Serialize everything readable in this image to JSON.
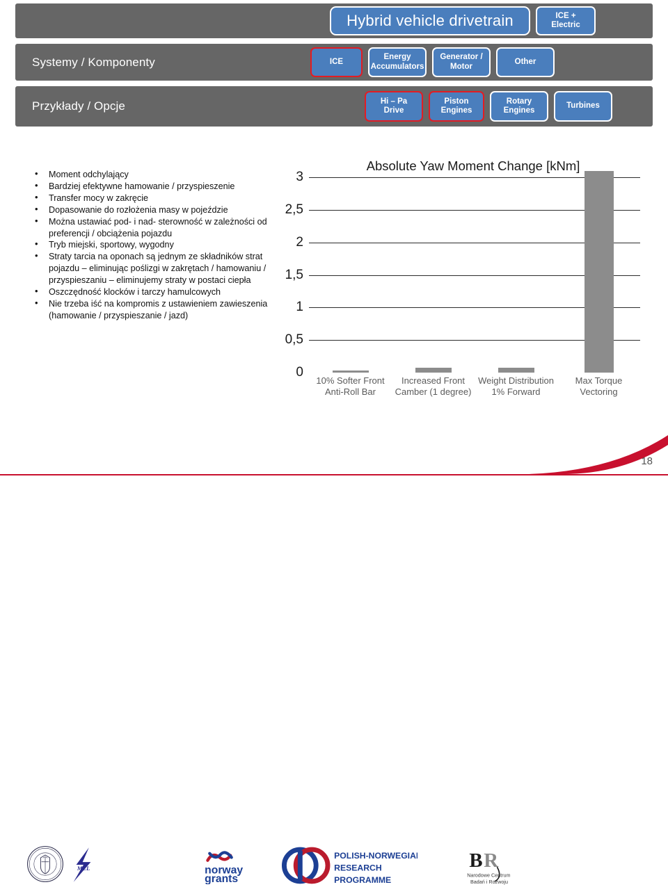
{
  "nav": {
    "rows": [
      {
        "label": "",
        "items": [
          {
            "name": "hybrid-vehicle-drivetrain",
            "label": "Hybrid vehicle drivetrain",
            "highlight": "white",
            "style": "title"
          },
          {
            "name": "ice-plus-electric",
            "label": "ICE +\nElectric",
            "highlight": "white",
            "style": "chip"
          }
        ]
      },
      {
        "label": "Systemy / Komponenty",
        "items": [
          {
            "name": "ice",
            "label": "ICE",
            "highlight": "red",
            "style": "chip"
          },
          {
            "name": "energy-accumulators",
            "label": "Energy\nAccumulators",
            "highlight": "white",
            "style": "chip"
          },
          {
            "name": "generator-motor",
            "label": "Generator /\nMotor",
            "highlight": "white",
            "style": "chip"
          },
          {
            "name": "other",
            "label": "Other",
            "highlight": "white",
            "style": "chip"
          }
        ]
      },
      {
        "label": "Przykłady / Opcje",
        "items": [
          {
            "name": "hi-pa-drive",
            "label": "Hi – Pa\nDrive",
            "highlight": "red",
            "style": "chip"
          },
          {
            "name": "piston-engines",
            "label": "Piston\nEngines",
            "highlight": "red",
            "style": "chip"
          },
          {
            "name": "rotary-engines",
            "label": "Rotary\nEngines",
            "highlight": "white",
            "style": "chip"
          },
          {
            "name": "turbines",
            "label": "Turbines",
            "highlight": "white",
            "style": "chip"
          }
        ]
      }
    ]
  },
  "bullets": [
    "Moment odchylający",
    "Bardziej efektywne hamowanie / przyspieszenie",
    "Transfer mocy w zakręcie",
    "Dopasowanie do rozłożenia masy w pojeździe",
    "Można ustawiać pod- i nad- sterowność w zależności od preferencji / obciążenia pojazdu",
    "Tryb miejski, sportowy, wygodny",
    "Straty tarcia na oponach są jednym ze składników strat pojazdu – eliminując poślizgi  w zakrętach / hamowaniu / przyspieszaniu – eliminujemy straty w postaci ciepła",
    "Oszczędność klocków i tarczy hamulcowych",
    "Nie trzeba iść na kompromis z ustawieniem zawieszenia (hamowanie / przyspieszanie / jazd)"
  ],
  "chart_data": {
    "type": "bar",
    "title": "Absolute Yaw Moment Change [kNm]",
    "xlabel": "",
    "ylabel": "",
    "categories": [
      "10% Softer Front Anti-Roll Bar",
      "Increased Front Camber (1 degree)",
      "Weight Distribution 1% Forward",
      "Max Torque Vectoring"
    ],
    "values": [
      0.03,
      0.07,
      0.08,
      3.1
    ],
    "ylim": [
      0,
      3.1
    ],
    "yticks": [
      "3",
      "2,5",
      "2",
      "1,5",
      "1",
      "0,5",
      "0"
    ],
    "ytick_values": [
      3,
      2.5,
      2,
      1.5,
      1,
      0.5,
      0
    ],
    "grid": true,
    "legend": "none",
    "bar_color": "#8c8c8c"
  },
  "footer": {
    "logos": [
      {
        "name": "university-seal",
        "caption": ""
      },
      {
        "name": "mel-logo",
        "caption": "MEL"
      },
      {
        "name": "norway-grants-logo",
        "caption_line1": "norway",
        "caption_line2": "grants"
      },
      {
        "name": "polish-norwegian-research-programme-logo",
        "line1": "Polish-Norwegian",
        "line2": "Research",
        "line3": "Programme"
      },
      {
        "name": "ncbr-logo",
        "mark": "BR",
        "line1": "Narodowe Centrum",
        "line2": "Badań i Rozwoju"
      }
    ],
    "page_number": "18"
  },
  "colors": {
    "nav_bar_gray": "#666666",
    "chip_blue": "#4a7ebd",
    "highlight_red": "#e31c23",
    "bar_gray": "#8c8c8c",
    "accent_red": "#c8102e"
  }
}
